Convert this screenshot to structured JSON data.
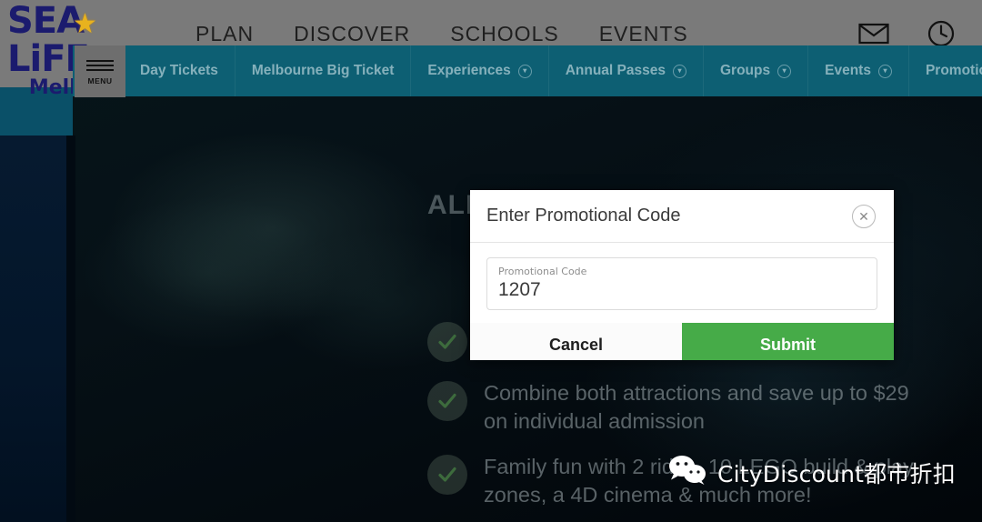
{
  "brand": {
    "logo_line1": "SEA LiFE",
    "logo_line2": "Melbourne",
    "star_glyph": "★"
  },
  "header": {
    "nav": [
      {
        "label": "PLAN"
      },
      {
        "label": "DISCOVER"
      },
      {
        "label": "SCHOOLS"
      },
      {
        "label": "EVENTS"
      }
    ],
    "icons": [
      {
        "name": "mail-icon"
      },
      {
        "name": "clock-icon"
      }
    ]
  },
  "menu_button": {
    "label": "MENU"
  },
  "subnav": {
    "items": [
      {
        "label": "Day Tickets",
        "has_caret": false
      },
      {
        "label": "Melbourne Big Ticket",
        "has_caret": false
      },
      {
        "label": "Experiences",
        "has_caret": true
      },
      {
        "label": "Annual Passes",
        "has_caret": true
      },
      {
        "label": "Groups",
        "has_caret": true
      },
      {
        "label": "Events",
        "has_caret": true
      },
      {
        "label": "Promotional Code",
        "has_caret": false
      }
    ],
    "caret_glyph": "▾"
  },
  "hero": {
    "title": "ALL AQUARIUM FLOOR",
    "bullets": [
      {
        "text": ""
      },
      {
        "text": "Combine both attractions and save up to $29 on individual admission"
      },
      {
        "text": "Family fun with 2 rides, 10 LEGO build & play zones, a 4D cinema & much more!"
      }
    ]
  },
  "modal": {
    "title": "Enter Promotional Code",
    "close_glyph": "✕",
    "field": {
      "label": "Promotional Code",
      "value": "1207",
      "placeholder": "Promotional Code"
    },
    "cancel_label": "Cancel",
    "submit_label": "Submit"
  },
  "watermark": {
    "text": "CityDiscount都市折扣",
    "icon": "wechat-icon"
  },
  "colors": {
    "subnav_teal": "#0d5f73",
    "header_grey": "#7a7a7a",
    "logo_navy": "#1b1b6e",
    "logo_star_gold": "#e8b21e",
    "submit_green": "#46ab48",
    "left_teal": "#0a5068",
    "left_navy": "#061a30"
  }
}
